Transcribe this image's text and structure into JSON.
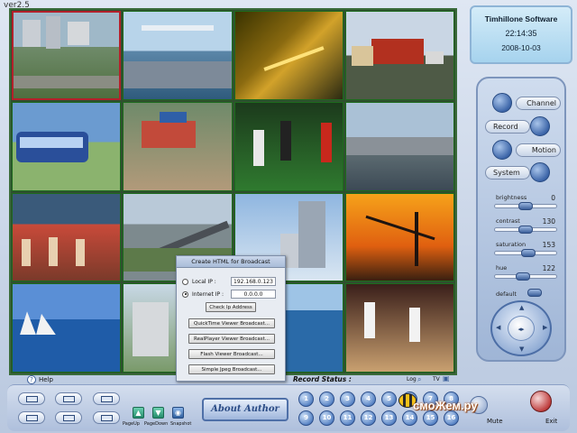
{
  "app": {
    "version": "ver2.5"
  },
  "clock": {
    "brand": "Timhillone Software",
    "time": "22:14:35",
    "date": "2008-10-03"
  },
  "panel": {
    "channel": "Channel",
    "record": "Record",
    "motion": "Motion",
    "system": "System",
    "sliders": [
      {
        "label": "brightness",
        "value": "0",
        "level": 0.5
      },
      {
        "label": "contrast",
        "value": "130",
        "level": 0.5
      },
      {
        "label": "saturation",
        "value": "153",
        "level": 0.55
      },
      {
        "label": "hue",
        "value": "122",
        "level": 0.45
      }
    ],
    "default_label": "default",
    "dpad_center": "◂▸"
  },
  "dialog": {
    "title": "Create HTML for Broadcast",
    "local_ip_label": "Local IP :",
    "local_ip": "192.168.0.123",
    "internet_ip_label": "Internet IP :",
    "internet_ip": "0.0.0.0",
    "check_button": "Check Ip Address",
    "quicktime_button": "QuickTime Viewer Broadcast...",
    "realplayer_button": "RealPlayer Viewer Broadcast...",
    "flash_button": "Flash Viewer Broadcast...",
    "jpeg_button": "Simple Jpeg Broadcast..."
  },
  "bottom": {
    "help": "Help",
    "record_status": "Record Status :",
    "log": "Log",
    "tv": "TV",
    "about": "About  Author",
    "pageup": "PageUp",
    "pagedown": "PageDown",
    "snapshot": "Snapshot",
    "mute": "Mute",
    "exit": "Exit",
    "channels_row1": [
      "1",
      "2",
      "3",
      "4",
      "5",
      "6",
      "7",
      "8"
    ],
    "channels_row2": [
      "9",
      "10",
      "11",
      "12",
      "13",
      "14",
      "15",
      "16"
    ],
    "watermark": "смоЖем.ру"
  },
  "colors": {
    "accent": "#3d66a9",
    "grid_border": "#3a6b3a",
    "selected_cell": "#b3202a"
  }
}
